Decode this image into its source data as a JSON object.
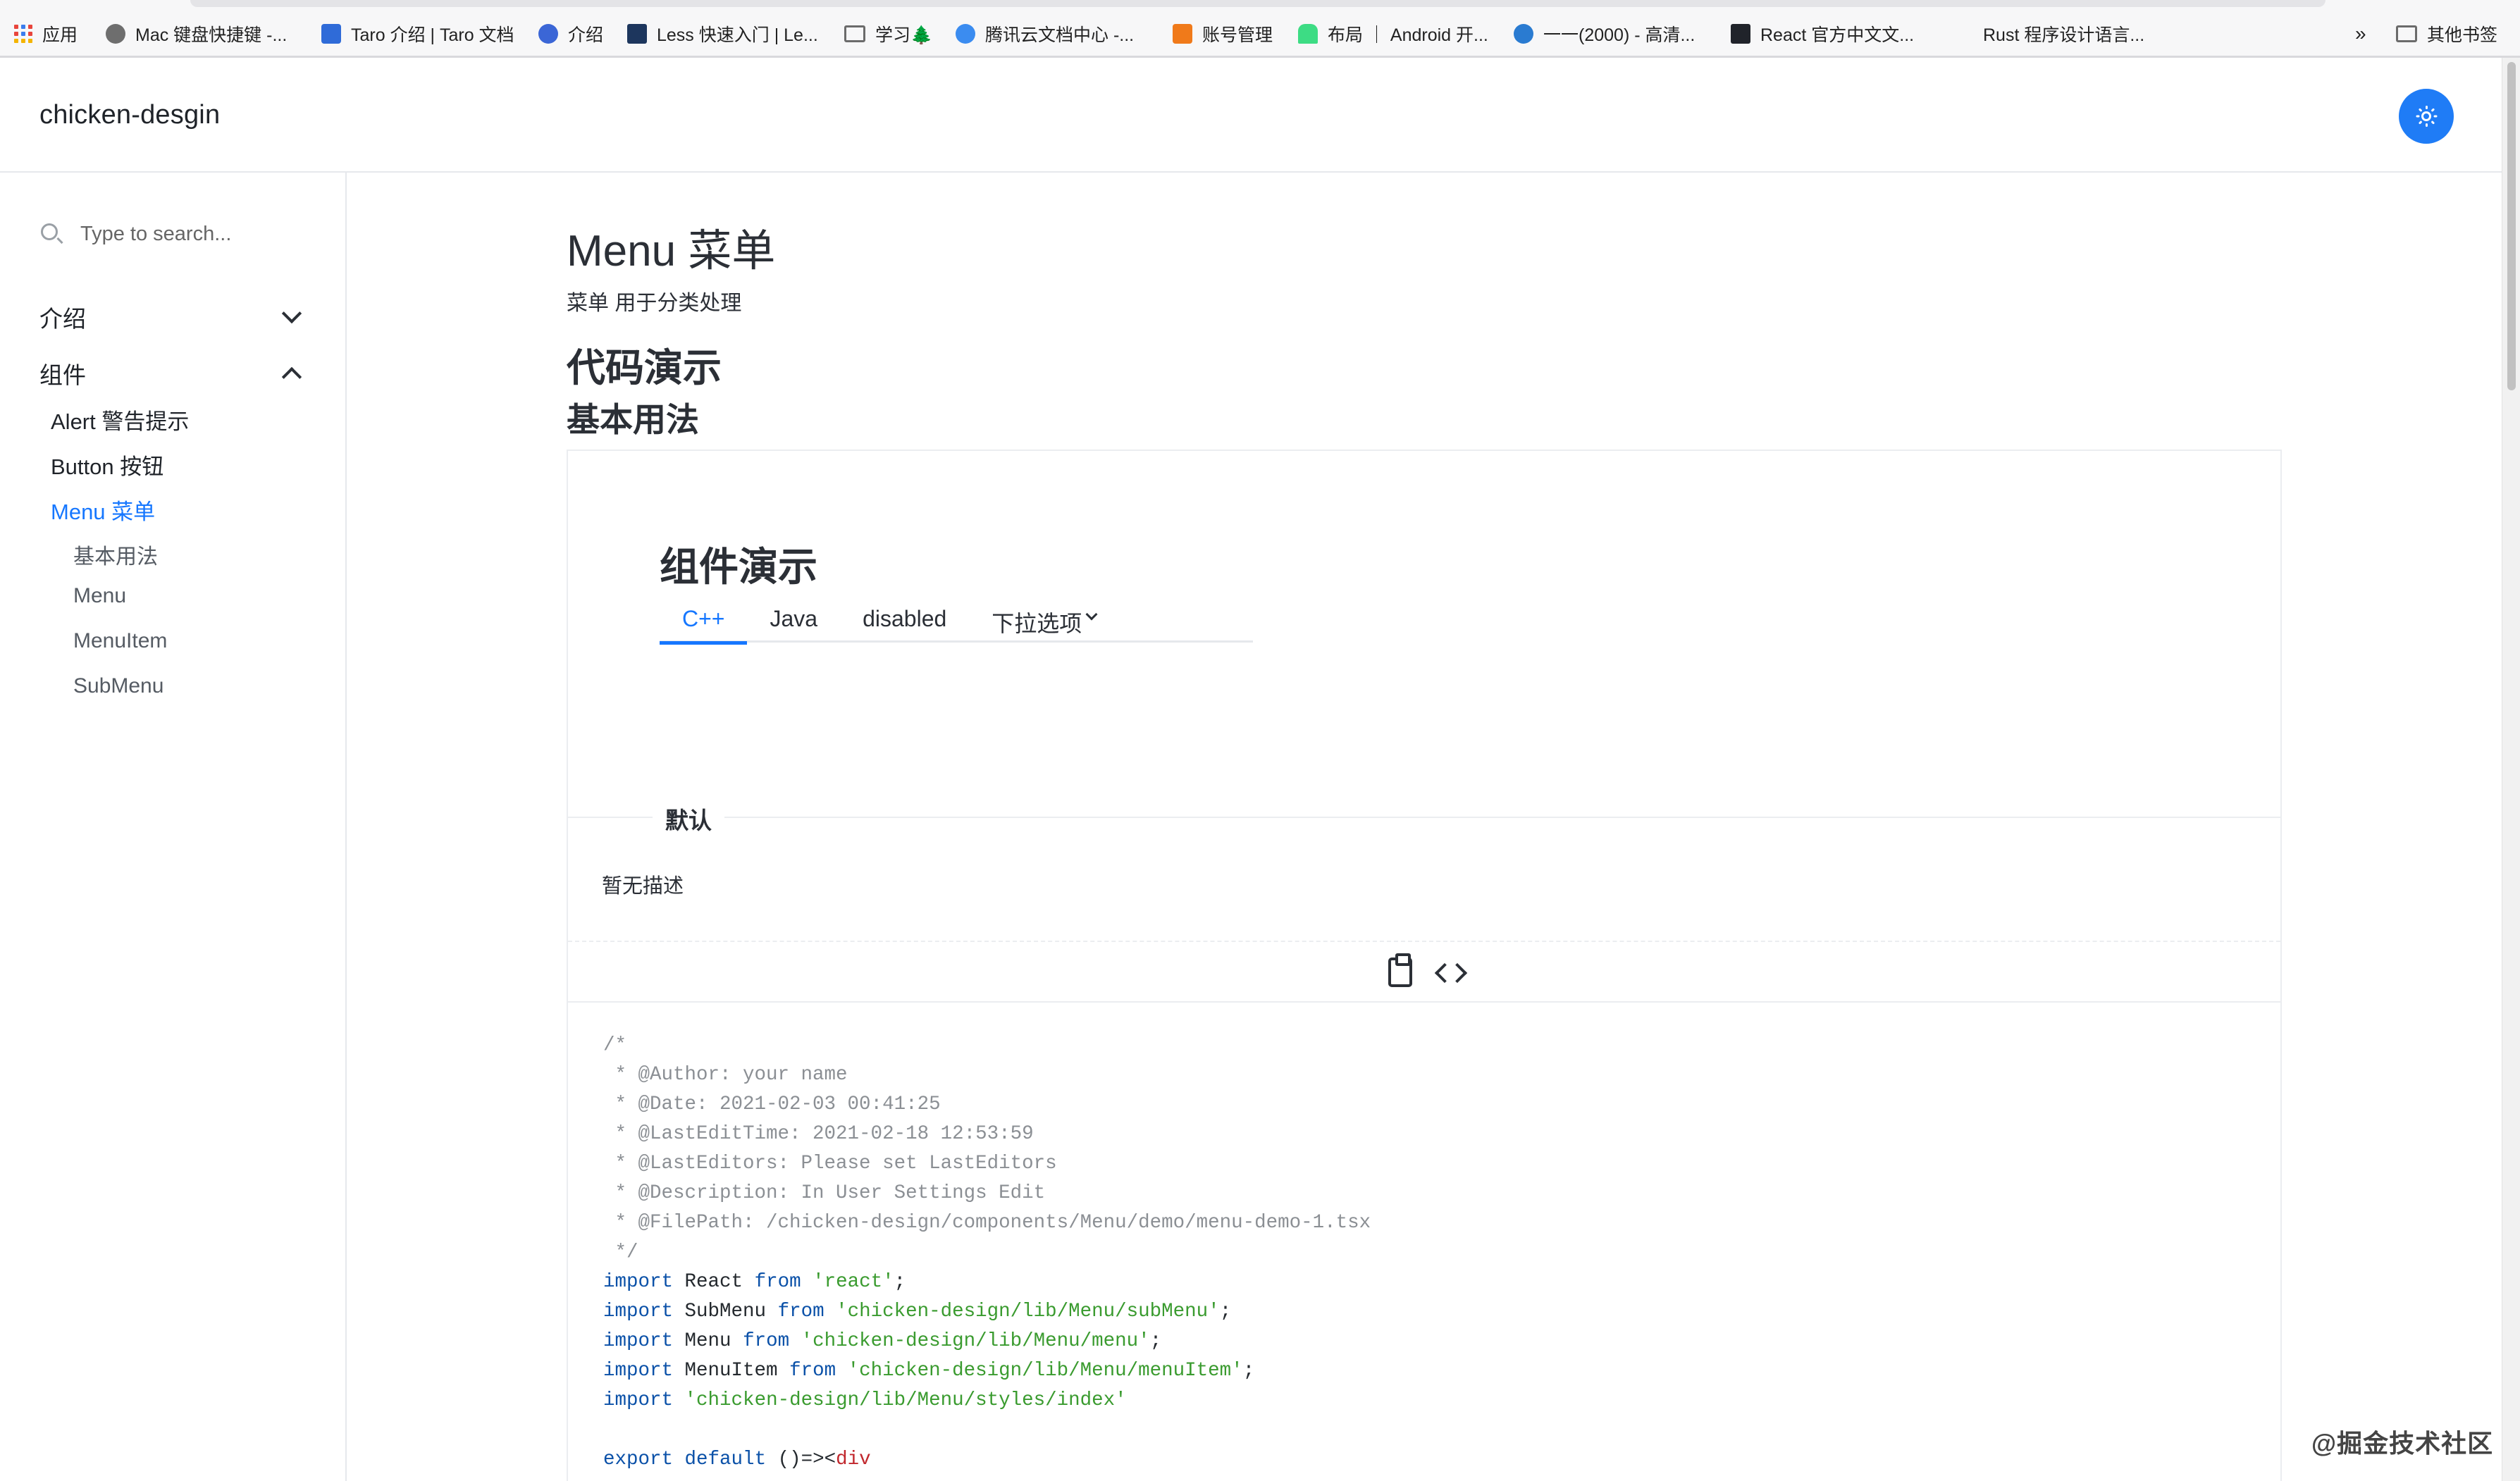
{
  "bookmarks": {
    "items": [
      {
        "label": "应用",
        "icon": "apps-grid-icon"
      },
      {
        "label": "Mac 键盘快捷键 -...",
        "icon": "apple-icon"
      },
      {
        "label": "Taro 介绍 | Taro 文档",
        "icon": "taro-icon"
      },
      {
        "label": "介绍",
        "icon": "globe-icon"
      },
      {
        "label": "Less 快速入门 | Le...",
        "icon": "less-icon"
      },
      {
        "label": "学习🌲",
        "icon": "folder-icon"
      },
      {
        "label": "腾讯云文档中心 -...",
        "icon": "cloud-icon"
      },
      {
        "label": "账号管理",
        "icon": "account-icon"
      },
      {
        "label": "布局 ｜ Android 开...",
        "icon": "android-icon"
      },
      {
        "label": "一一(2000) - 高清...",
        "icon": "p-icon"
      },
      {
        "label": "React 官方中文文...",
        "icon": "react-icon"
      },
      {
        "label": "Rust 程序设计语言...",
        "icon": "rust-icon"
      }
    ],
    "overflow": "»",
    "other": "其他书签"
  },
  "header": {
    "logo": "chicken-desgin",
    "theme_icon": "sun-icon",
    "accent": "#1f7cf6"
  },
  "sidebar": {
    "search_placeholder": "Type to search...",
    "groups": [
      {
        "label": "介绍",
        "expanded": false
      },
      {
        "label": "组件",
        "expanded": true
      }
    ],
    "items": [
      {
        "label": "Alert 警告提示"
      },
      {
        "label": "Button 按钮"
      },
      {
        "label": "Menu 菜单",
        "active": true
      }
    ],
    "subitems": [
      "基本用法",
      "Menu",
      "MenuItem",
      "SubMenu"
    ],
    "active_color": "#1677ff"
  },
  "main": {
    "title": "Menu 菜单",
    "description": "菜单 用于分类处理",
    "h2": "代码演示",
    "h3": "基本用法",
    "demo": {
      "heading": "组件演示",
      "tabs": [
        {
          "label": "C++",
          "active": true
        },
        {
          "label": "Java"
        },
        {
          "label": "disabled"
        },
        {
          "label": "下拉选项",
          "dropdown": true
        }
      ],
      "meta_title": "默认",
      "meta_desc": "暂无描述"
    },
    "code_lines": [
      "/*",
      " * @Author: your name",
      " * @Date: 2021-02-03 00:41:25",
      " * @LastEditTime: 2021-02-18 12:53:59",
      " * @LastEditors: Please set LastEditors",
      " * @Description: In User Settings Edit",
      " * @FilePath: /chicken-design/components/Menu/demo/menu-demo-1.tsx",
      " */",
      "import React from 'react';",
      "import SubMenu from 'chicken-design/lib/Menu/subMenu';",
      "import Menu from 'chicken-design/lib/Menu/menu';",
      "import MenuItem from 'chicken-design/lib/Menu/menuItem';",
      "import 'chicken-design/lib/Menu/styles/index'",
      "",
      "export default ()=><div"
    ]
  },
  "watermark": "@掘金技术社区"
}
